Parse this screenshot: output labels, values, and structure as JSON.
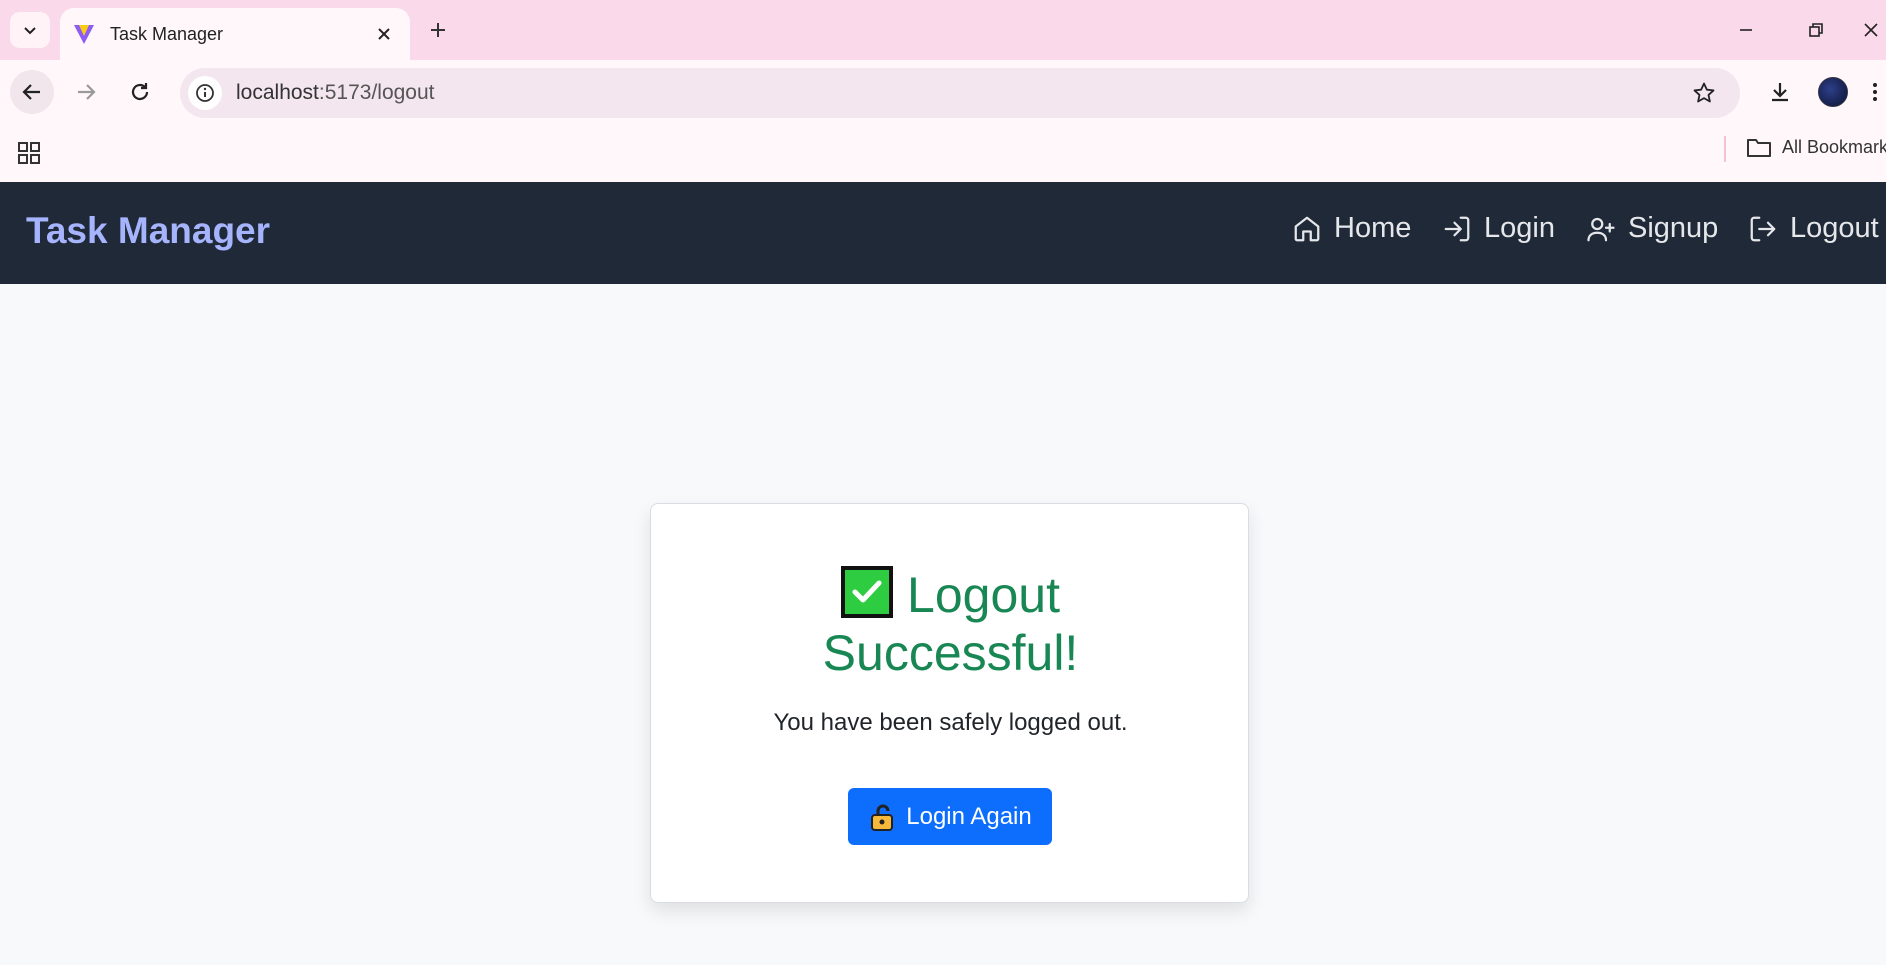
{
  "browser": {
    "tab_title": "Task Manager",
    "url_host": "localhost",
    "url_path": ":5173/logout",
    "bookmarks_label": "All Bookmarks"
  },
  "app": {
    "brand": "Task Manager",
    "nav": {
      "home": "Home",
      "login": "Login",
      "signup": "Signup",
      "logout": "Logout"
    }
  },
  "card": {
    "title_line1": "Logout",
    "title_line2": "Successful!",
    "message": "You have been safely logged out.",
    "button_label": "Login Again"
  },
  "colors": {
    "navbar_bg": "#1f2937",
    "brand": "#a5b4fc",
    "success": "#198754",
    "primary_button": "#0d6efd"
  },
  "icons": [
    "chevron-down-icon",
    "vite-favicon-icon",
    "close-icon",
    "plus-icon",
    "minimize-icon",
    "restore-icon",
    "back-arrow-icon",
    "forward-arrow-icon",
    "reload-icon",
    "info-icon",
    "star-icon",
    "download-icon",
    "apps-grid-icon",
    "folder-icon",
    "home-icon",
    "login-icon",
    "user-plus-icon",
    "logout-icon",
    "check-mark-emoji",
    "lock-emoji"
  ]
}
